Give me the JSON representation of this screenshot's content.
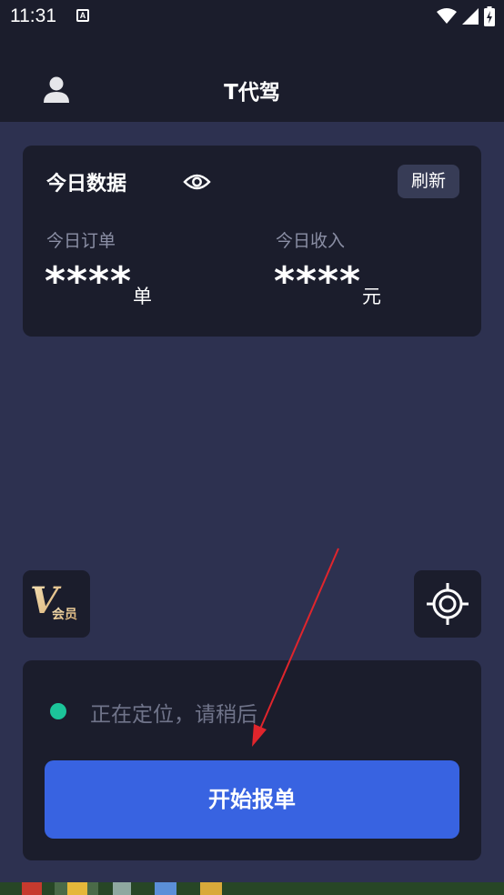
{
  "status_bar": {
    "time": "11:31",
    "notification_letter": "A"
  },
  "header": {
    "title": "T代驾"
  },
  "stats": {
    "title": "今日数据",
    "refresh_label": "刷新",
    "orders": {
      "label": "今日订单",
      "value": "****",
      "unit": "单"
    },
    "income": {
      "label": "今日收入",
      "value": "****",
      "unit": "元"
    }
  },
  "vip": {
    "letter": "V",
    "label": "会员"
  },
  "location": {
    "status_text": "正在定位，请稍后",
    "status_color": "#1cc59a"
  },
  "actions": {
    "start_label": "开始报单"
  },
  "colors": {
    "accent": "#3863e1",
    "background": "#2d3150",
    "card": "#1b1d2c",
    "annotation_arrow": "#e0252c"
  }
}
